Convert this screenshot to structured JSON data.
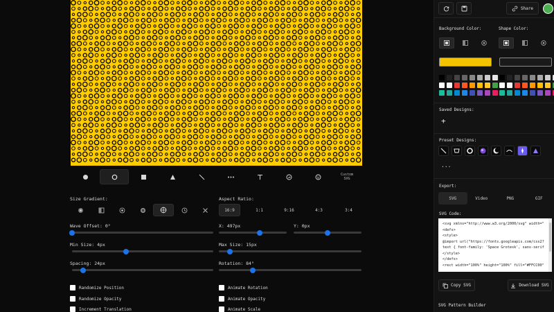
{
  "shape_bar": {
    "custom_svg_label_line1": "Custom",
    "custom_svg_label_line2": "SVG",
    "shapes": [
      "circle",
      "ring",
      "square",
      "triangle",
      "line",
      "dots",
      "text",
      "spiral",
      "emoji",
      "custom"
    ],
    "active": "ring"
  },
  "canvas": {
    "background": "#FFCC00",
    "shape_color": "#000000"
  },
  "controls": {
    "size_gradient_label": "Size Gradient:",
    "aspect_ratio_label": "Aspect Ratio:",
    "aspect_ratios": [
      "16:9",
      "1:1",
      "9:16",
      "4:3",
      "3:4"
    ],
    "aspect_ratio_active": "16:9",
    "wave_offset_label": "Wave Offset: 0°",
    "wave_offset": 0,
    "x_label": "X: 497px",
    "x_value": 0.6,
    "y_label": "Y: 0px",
    "y_value": 0.5,
    "min_size_label": "Min Size: 4px",
    "min_size": 0.38,
    "max_size_label": "Max Size: 15px",
    "max_size": 0.08,
    "spacing_label": "Spacing: 24px",
    "spacing": 0.08,
    "rotation_label": "Rotation: 84°",
    "rotation": 0.24,
    "checkboxes": {
      "randomize_position": "Randomize Position",
      "randomize_opacity": "Randomize Opacity",
      "increment_translation": "Increment Translation",
      "animate_rotation": "Animate Rotation",
      "animate_opacity": "Animate Opacity",
      "animate_scale": "Animate Scale"
    }
  },
  "sidebar": {
    "share_label": "Share",
    "background_color_label": "Background Color:",
    "shape_color_label": "Shape Color:",
    "background_color": "#F5C400",
    "shape_color": "#1a1a1a",
    "saved_designs_label": "Saved Designs:",
    "add_label": "+",
    "preset_designs_label": "Preset Designs:",
    "more_label": "...",
    "export_label": "Export:",
    "export_tabs": [
      "SVG",
      "Video",
      "PNG",
      "GIF"
    ],
    "export_active": "SVG",
    "svg_code_label": "SVG Code:",
    "svg_code": "<svg xmlns=\"http://www.w3.org/2000/svg\" width=\"\n<defs>\n<style>\n@import url(\"https://fonts.googleapis.com/css2?\ntext { font-family: 'Space Grotesk', sans-serif\n</style>\n</defs>\n<rect width=\"100%\" height=\"100%\" fill=\"#FFCC00\"",
    "copy_svg_label": "Copy SVG",
    "download_svg_label": "Download SVG",
    "footer_title": "SVG Pattern Builder",
    "swatches": [
      "#000000",
      "#222222",
      "#444444",
      "#666666",
      "#888888",
      "#aaaaaa",
      "#cccccc",
      "#e6e6e6",
      "#ffffff",
      "#f5f5f5",
      "#e53935",
      "#ff5722",
      "#ff9800",
      "#ffc107",
      "#ffca28",
      "#43a047",
      "#1abc9c",
      "#26a69a",
      "#0288d1",
      "#1e88e5",
      "#3f51b5",
      "#7e57c2",
      "#ab47bc",
      "#e91e63"
    ]
  }
}
